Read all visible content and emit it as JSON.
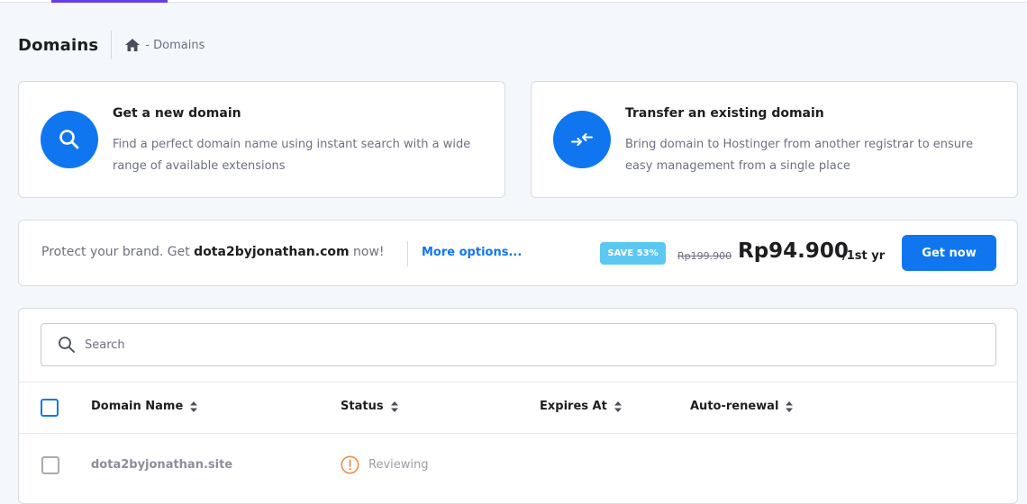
{
  "header": {
    "title": "Domains",
    "breadcrumb_sep_text": "- Domains"
  },
  "cards": [
    {
      "title": "Get a new domain",
      "description": "Find a perfect domain name using instant search with a wide range of available extensions",
      "icon": "search-icon"
    },
    {
      "title": "Transfer an existing domain",
      "description": "Bring domain to Hostinger from another registrar to ensure easy management from a single place",
      "icon": "transfer-arrows-icon"
    }
  ],
  "promo": {
    "prefix": "Protect your brand. Get",
    "domain": "dota2byjonathan.com",
    "suffix": "now!",
    "more_options": "More options...",
    "save_badge": "SAVE 53%",
    "old_price": "Rp199.900",
    "new_price": "Rp94.900",
    "per": "/1st yr",
    "button": "Get now"
  },
  "table": {
    "search_placeholder": "Search",
    "columns": [
      "Domain Name",
      "Status",
      "Expires At",
      "Auto-renewal"
    ],
    "rows": [
      {
        "domain": "dota2byjonathan.site",
        "status": "Reviewing",
        "expires": "",
        "auto_renewal": ""
      }
    ]
  },
  "colors": {
    "accent": "#1076f0",
    "badge": "#5cc8f2",
    "warning": "#f08c4c"
  }
}
